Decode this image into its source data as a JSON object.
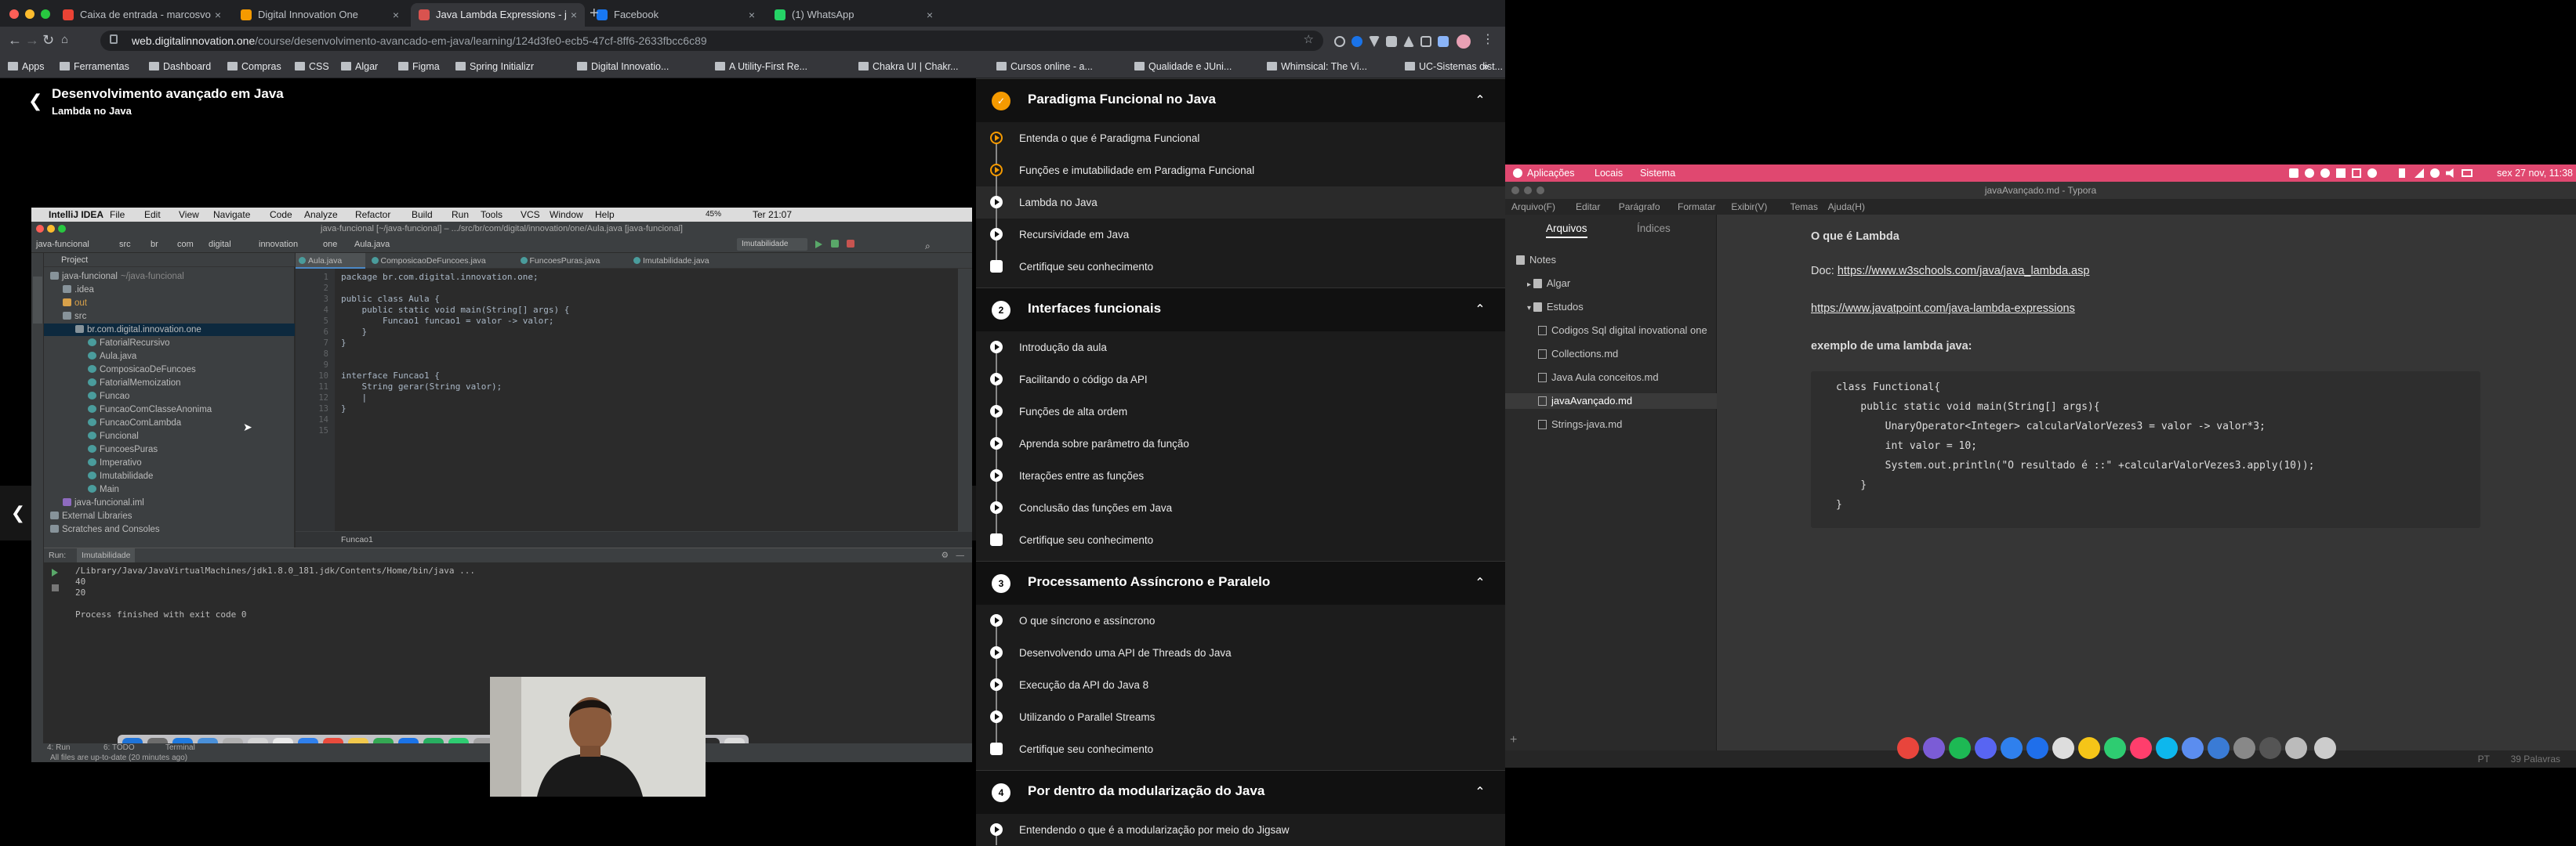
{
  "browser": {
    "tabs": [
      {
        "title": "Caixa de entrada - marcosvo",
        "favicon": "gmail-icon",
        "color": "#ea4335"
      },
      {
        "title": "Digital Innovation One",
        "favicon": "dio-icon",
        "color": "#f59a00"
      },
      {
        "title": "Java Lambda Expressions - j",
        "favicon": "w3schools-icon",
        "color": "#d9534f",
        "active": true
      },
      {
        "title": "Facebook",
        "favicon": "facebook-icon",
        "color": "#1877f2"
      },
      {
        "title": "(1) WhatsApp",
        "favicon": "whatsapp-icon",
        "color": "#25d366"
      }
    ],
    "url_host": "web.digitalinnovation.one",
    "url_path": "/course/desenvolvimento-avancado-em-java/learning/124d3fe0-ecb5-47cf-8ff6-2633fbcc6c89",
    "bookmarks": [
      "Apps",
      "Ferramentas",
      "Dashboard",
      "Compras",
      "CSS",
      "Algar",
      "Figma",
      "Spring Initializr",
      "Digital Innovatio...",
      "A Utility-First Re...",
      "Chakra UI | Chakr...",
      "Cursos online - a...",
      "Qualidade e JUni...",
      "Whimsical: The Vi...",
      "UC-Sistemas dist..."
    ]
  },
  "lesson": {
    "course_title": "Desenvolvimento avançado em Java",
    "lesson_title": "Lambda no Java"
  },
  "ide": {
    "app_name": "IntelliJ IDEA",
    "menu": [
      "File",
      "Edit",
      "View",
      "Navigate",
      "Code",
      "Analyze",
      "Refactor",
      "Build",
      "Run",
      "Tools",
      "VCS",
      "Window",
      "Help"
    ],
    "clock": "Ter 21:07",
    "battery": "45%",
    "window_title": "java-funcional [~/java-funcional] – .../src/br/com/digital/innovation/one/Aula.java [java-funcional]",
    "breadcrumb": [
      "java-funcional",
      "src",
      "br",
      "com",
      "digital",
      "innovation",
      "one",
      "Aula.java"
    ],
    "run_config": "Imutabilidade",
    "project_label": "Project",
    "tree": [
      {
        "label": "java-funcional",
        "extra": "~/java-funcional",
        "indent": 0,
        "type": "folder"
      },
      {
        "label": ".idea",
        "indent": 1,
        "type": "folder"
      },
      {
        "label": "out",
        "indent": 1,
        "type": "folder-orange"
      },
      {
        "label": "src",
        "indent": 1,
        "type": "folder"
      },
      {
        "label": "br.com.digital.innovation.one",
        "indent": 2,
        "type": "package",
        "selected": true
      },
      {
        "label": "FatorialRecursivo",
        "indent": 3,
        "type": "class"
      },
      {
        "label": "Aula.java",
        "indent": 3,
        "type": "class"
      },
      {
        "label": "ComposicaoDeFuncoes",
        "indent": 3,
        "type": "class"
      },
      {
        "label": "FatorialMemoization",
        "indent": 3,
        "type": "class"
      },
      {
        "label": "Funcao",
        "indent": 3,
        "type": "class"
      },
      {
        "label": "FuncaoComClasseAnonima",
        "indent": 3,
        "type": "class"
      },
      {
        "label": "FuncaoComLambda",
        "indent": 3,
        "type": "class"
      },
      {
        "label": "Funcional",
        "indent": 3,
        "type": "class"
      },
      {
        "label": "FuncoesPuras",
        "indent": 3,
        "type": "class"
      },
      {
        "label": "Imperativo",
        "indent": 3,
        "type": "class"
      },
      {
        "label": "Imutabilidade",
        "indent": 3,
        "type": "class"
      },
      {
        "label": "Main",
        "indent": 3,
        "type": "class"
      },
      {
        "label": "java-funcional.iml",
        "indent": 1,
        "type": "file"
      },
      {
        "label": "External Libraries",
        "indent": 0,
        "type": "lib"
      },
      {
        "label": "Scratches and Consoles",
        "indent": 0,
        "type": "lib"
      }
    ],
    "editor_tabs": [
      "Aula.java",
      "ComposicaoDeFuncoes.java",
      "FuncoesPuras.java",
      "Imutabilidade.java"
    ],
    "line_numbers": [
      "1",
      "2",
      "3",
      "4",
      "5",
      "6",
      "7",
      "8",
      "9",
      "10",
      "11",
      "12",
      "13",
      "14",
      "15"
    ],
    "code_lines": [
      "package br.com.digital.innovation.one;",
      "",
      "public class Aula {",
      "    public static void main(String[] args) {",
      "        Funcao1 funcao1 = valor -> valor;",
      "    }",
      "}",
      "",
      "",
      "interface Funcao1 {",
      "    String gerar(String valor);",
      "    |",
      "}",
      "",
      ""
    ],
    "editor_footer": "Funcao1",
    "run_label": "Run:",
    "run_tab": "Imutabilidade",
    "run_output": [
      "/Library/Java/JavaVirtualMachines/jdk1.8.0_181.jdk/Contents/Home/bin/java ...",
      "40",
      "20",
      "",
      "Process finished with exit code 0"
    ],
    "bottom_tabs": [
      "4: Run",
      "6: TODO",
      "Terminal"
    ],
    "status": "All files are up-to-date (20 minutes ago)"
  },
  "modules": [
    {
      "number": "",
      "title": "Paradigma Funcional no Java",
      "lessons": [
        {
          "label": "Entenda o que é Paradigma Funcional",
          "state": "done"
        },
        {
          "label": "Funções e imutabilidade em Paradigma Funcional",
          "state": "done"
        },
        {
          "label": "Lambda no Java",
          "state": "current"
        },
        {
          "label": "Recursividade em Java",
          "state": "todo"
        },
        {
          "label": "Certifique seu conhecimento",
          "state": "cert"
        }
      ]
    },
    {
      "number": "2",
      "title": "Interfaces funcionais",
      "lessons": [
        {
          "label": "Introdução da aula",
          "state": "todo"
        },
        {
          "label": "Facilitando o código da API",
          "state": "todo"
        },
        {
          "label": "Funções de alta ordem",
          "state": "todo"
        },
        {
          "label": "Aprenda sobre parâmetro da função",
          "state": "todo"
        },
        {
          "label": "Iterações entre as funções",
          "state": "todo"
        },
        {
          "label": "Conclusão das funções em Java",
          "state": "todo"
        },
        {
          "label": "Certifique seu conhecimento",
          "state": "cert"
        }
      ]
    },
    {
      "number": "3",
      "title": "Processamento Assíncrono e Paralelo",
      "lessons": [
        {
          "label": "O que síncrono e assíncrono",
          "state": "todo"
        },
        {
          "label": "Desenvolvendo uma API de Threads do Java",
          "state": "todo"
        },
        {
          "label": "Execução da API do Java 8",
          "state": "todo"
        },
        {
          "label": "Utilizando o Parallel Streams",
          "state": "todo"
        },
        {
          "label": "Certifique seu conhecimento",
          "state": "cert"
        }
      ]
    },
    {
      "number": "4",
      "title": "Por dentro da modularização do Java",
      "lessons": [
        {
          "label": "Entendendo o que é a modularização por meio do Jigsaw",
          "state": "todo"
        }
      ]
    }
  ],
  "desktop": {
    "topbar": {
      "menus": [
        "Aplicações",
        "Locais",
        "Sistema"
      ],
      "clock": "sex 27 nov, 11:38"
    },
    "typora": {
      "title": "javaAvançado.md - Typora",
      "menu": [
        "Arquivo(F)",
        "Editar",
        "Parágrafo",
        "Formatar",
        "Exibir(V)",
        "Temas",
        "Ajuda(H)"
      ],
      "sidebar_tabs": [
        "Arquivos",
        "Índices"
      ],
      "files": [
        {
          "label": "Notes",
          "indent": 0,
          "type": "folder"
        },
        {
          "label": "Algar",
          "indent": 1,
          "type": "folder"
        },
        {
          "label": "Estudos",
          "indent": 1,
          "type": "folder"
        },
        {
          "label": "Codigos Sql digital inovational one",
          "indent": 2,
          "type": "doc"
        },
        {
          "label": "Collections.md",
          "indent": 2,
          "type": "doc"
        },
        {
          "label": "Java Aula conceitos.md",
          "indent": 2,
          "type": "doc"
        },
        {
          "label": "javaAvançado.md",
          "indent": 2,
          "type": "doc",
          "selected": true
        },
        {
          "label": "Strings-java.md",
          "indent": 2,
          "type": "doc"
        }
      ],
      "doc": {
        "heading": "O que é Lambda",
        "doc_prefix": "Doc: ",
        "link1": "https://www.w3schools.com/java/java_lambda.asp",
        "link2": "https://www.javatpoint.com/java-lambda-expressions",
        "example_heading": "exemplo de uma lambda java:",
        "code": [
          "class Functional{",
          "    public static void main(String[] args){",
          "        UnaryOperator<Integer> calcularValorVezes3 = valor -> valor*3;",
          "        int valor = 10;",
          "        System.out.println(\"O resultado é ::\" +calcularValorVezes3.apply(10));",
          "    }",
          "}"
        ]
      },
      "status_lang": "PT",
      "word_count": "39 Palavras"
    }
  }
}
